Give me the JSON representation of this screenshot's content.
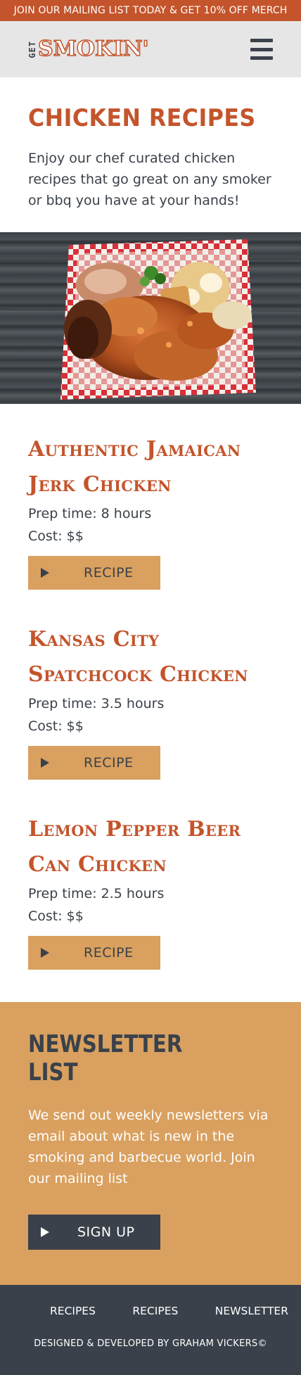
{
  "promo": {
    "text": "JOIN OUR MAILING LIST TODAY & GET 10% OFF MERCH"
  },
  "header": {
    "logo_get": "GET",
    "logo_smokin": "SMOKIN'",
    "menu_icon": "hamburger-menu-icon"
  },
  "intro": {
    "title": "CHICKEN RECIPES",
    "text": "Enjoy our chef curated chicken recipes that go great on any smoker or bbq you have at your hands!"
  },
  "recipes": [
    {
      "name": "Authentic Jamaican Jerk Chicken",
      "prep": "Prep time: 8 hours",
      "cost": "Cost: $$",
      "button": "RECIPE"
    },
    {
      "name": "Kansas City Spatchcock Chicken",
      "prep": "Prep time: 3.5 hours",
      "cost": "Cost: $$",
      "button": "RECIPE"
    },
    {
      "name": "Lemon Pepper Beer Can Chicken",
      "prep": "Prep time: 2.5 hours",
      "cost": "Cost: $$",
      "button": "RECIPE"
    }
  ],
  "newsletter": {
    "title": "NEWSLETTER LIST",
    "text": "We send out weekly newsletters via email about what is new in the smoking and barbecue world. Join our mailing list",
    "button": "SIGN UP"
  },
  "footer": {
    "links": [
      "RECIPES",
      "RECIPES",
      "NEWSLETTER"
    ],
    "credit": "DESIGNED & DEVELOPED BY GRAHAM VICKERS©"
  },
  "colors": {
    "brand_orange": "#c4542b",
    "accent_tan": "#d9a05f",
    "slate": "#3a414a",
    "header_gray": "#e6e6e6"
  }
}
